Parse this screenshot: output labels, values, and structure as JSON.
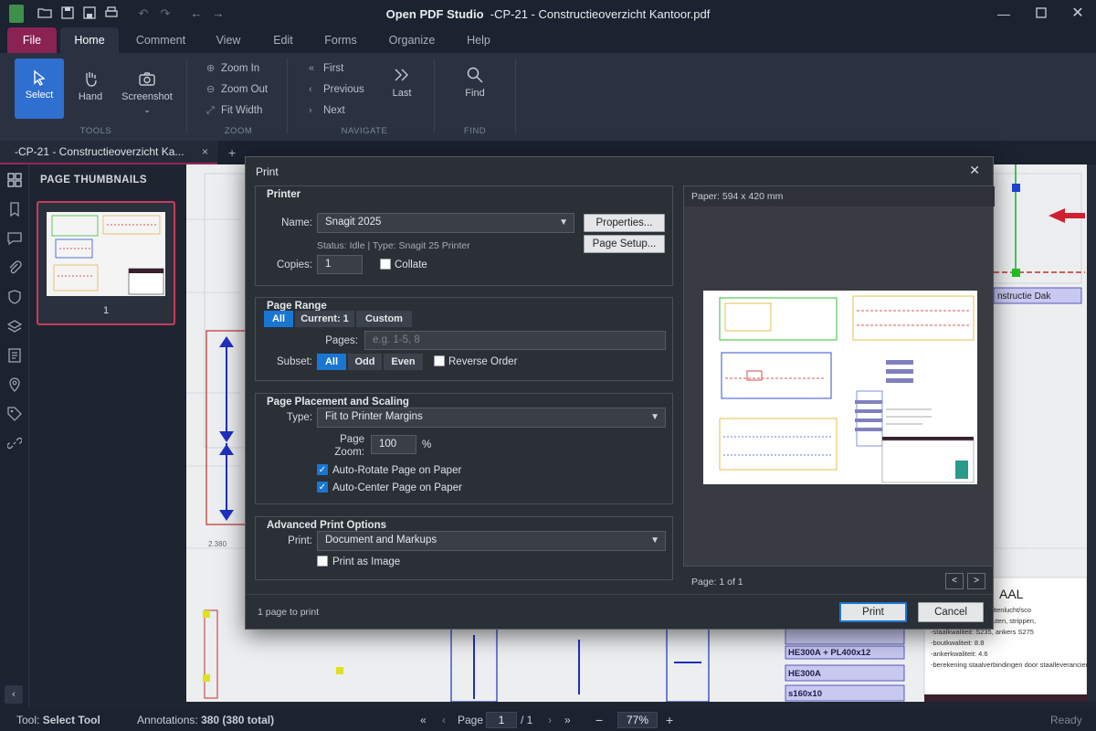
{
  "app": {
    "name": "Open PDF Studio",
    "document_title": "-CP-21 - Constructieoverzicht Kantoor.pdf"
  },
  "menu": {
    "file": "File",
    "tabs": [
      "Home",
      "Comment",
      "View",
      "Edit",
      "Forms",
      "Organize",
      "Help"
    ]
  },
  "ribbon": {
    "tools": {
      "select": "Select",
      "hand": "Hand",
      "screenshot": "Screenshot",
      "group": "TOOLS"
    },
    "zoom": {
      "zoom_in": "Zoom In",
      "zoom_out": "Zoom Out",
      "fit_width": "Fit Width",
      "group": "ZOOM"
    },
    "navigate": {
      "first": "First",
      "previous": "Previous",
      "next": "Next",
      "last": "Last",
      "group": "NAVIGATE"
    },
    "find": {
      "find": "Find",
      "group": "FIND"
    }
  },
  "doc_tab": {
    "label": "-CP-21 - Constructieoverzicht Ka...",
    "close": "×",
    "add": "+"
  },
  "thumbnails": {
    "title": "PAGE THUMBNAILS",
    "page_number": "1"
  },
  "print_dialog": {
    "title": "Print",
    "printer": {
      "section": "Printer",
      "name_label": "Name:",
      "name_value": "Snagit 2025",
      "properties": "Properties...",
      "page_setup": "Page Setup...",
      "status": "Status: Idle  |  Type: Snagit 25 Printer",
      "copies_label": "Copies:",
      "copies_value": "1",
      "collate": "Collate"
    },
    "page_range": {
      "section": "Page Range",
      "options": [
        "All",
        "Current: 1",
        "Custom"
      ],
      "pages_label": "Pages:",
      "pages_placeholder": "e.g. 1-5, 8",
      "subset_label": "Subset:",
      "subset_options": [
        "All",
        "Odd",
        "Even"
      ],
      "reverse_order": "Reverse Order"
    },
    "placement": {
      "section": "Page Placement and Scaling",
      "type_label": "Type:",
      "type_value": "Fit to Printer Margins",
      "zoom_label_1": "Page",
      "zoom_label_2": "Zoom:",
      "zoom_value": "100",
      "zoom_unit": "%",
      "auto_rotate": "Auto-Rotate Page on Paper",
      "auto_center": "Auto-Center Page on Paper"
    },
    "advanced": {
      "section": "Advanced Print Options",
      "print_label": "Print:",
      "print_value": "Document and Markups",
      "print_as_image": "Print as Image"
    },
    "preview": {
      "paper": "Paper: 594 x 420 mm",
      "page_info": "Page: 1 of 1",
      "prev": "<",
      "next": ">"
    },
    "footer": {
      "note": "1 page to print",
      "print": "Print",
      "cancel": "Cancel"
    }
  },
  "document_labels": {
    "dak": "nstructie Dak",
    "aal": "AAL",
    "he300a_pl": "HE300A + PL400x12",
    "he300a": "HE300A",
    "s160": "s160x10",
    "dim": "2.380",
    "note_1": "aanraking met de buitenlucht/sco",
    "note_2": "rzien van ankers, bouten, strippen,",
    "note_3": "-staalkwaliteit: S235, ankers S275",
    "note_4": "-boutkwaliteit: 8.8",
    "note_5": "-ankerkwaliteit: 4.6",
    "note_6": "-berekening staalverbindingen door staalleverancier te verz"
  },
  "statusbar": {
    "tool_label": "Tool:",
    "tool_value": "Select Tool",
    "annotations_label": "Annotations:",
    "annotations_value": "380 (380 total)",
    "page_label": "Page",
    "page_value": "1",
    "page_total": "/ 1",
    "zoom_value": "77%",
    "ready": "Ready"
  },
  "colors": {
    "accent": "#1976d2",
    "file_tab": "#8a2254",
    "thumb_border": "#c83a5c"
  }
}
